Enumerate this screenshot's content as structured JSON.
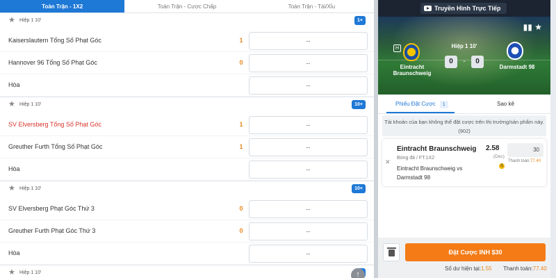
{
  "tabs": [
    "Toàn Trận - 1X2",
    "Toàn Trận - Cược Chấp",
    "Toàn Trận - Tài/Xỉu"
  ],
  "markets": [
    {
      "time": "Hiệp 1 10'",
      "more": "1+",
      "rows": [
        {
          "name": "Kaiserslautern Tổng Số Phạt Góc",
          "num": "1",
          "odd": "--"
        },
        {
          "name": "Hannover 96 Tổng Số Phạt Góc",
          "num": "0",
          "odd": "--"
        },
        {
          "name": "Hòa",
          "num": "",
          "odd": "--"
        }
      ]
    },
    {
      "time": "Hiệp 1 10'",
      "more": "10+",
      "rows": [
        {
          "name": "SV Elversberg Tổng Số Phạt Góc",
          "num": "1",
          "odd": "--"
        },
        {
          "name": "Greuther Furth Tổng Số Phạt Góc",
          "num": "1",
          "odd": "--"
        },
        {
          "name": "Hòa",
          "num": "",
          "odd": "--"
        }
      ]
    },
    {
      "time": "Hiệp 1 10'",
      "more": "10+",
      "rows": [
        {
          "name": "SV Elversberg Phạt Góc Thứ 3",
          "num": "0",
          "odd": "--"
        },
        {
          "name": "Greuther Furth Phạt Góc Thứ 3",
          "num": "0",
          "odd": "--"
        },
        {
          "name": "Hòa",
          "num": "",
          "odd": "--"
        }
      ]
    },
    {
      "time": "Hiệp 1 10'",
      "more": "1+",
      "rows": []
    }
  ],
  "live": {
    "button": "Truyền Hình Trực Tiếp",
    "home_badge": "H",
    "time": "Hiệp 1 10'",
    "home_team": "Eintracht Braunschweig",
    "away_team": "Darmstadt 98",
    "home_score": "0",
    "away_score": "0",
    "dash": "-"
  },
  "betslip": {
    "tab_slip": "Phiếu Đặt Cược",
    "slip_count": "1",
    "tab_statement": "Sao kê",
    "warning": "Tài khoản của bạn không thể đặt cược trên thị trường/sản phẩm này. (902)",
    "selection": "Eintracht Braunschweig",
    "odds": "2.58",
    "odds_format": "(Dec)",
    "league": "Bóng đá / FT.1X2",
    "match": "Eintracht Braunschweig vs Darmstadt 98",
    "stake": "30",
    "payout_label": "Thanh toán:",
    "payout_value": "77.40",
    "place_button": "Đặt Cược INH $30",
    "balance_label": "Số dư hiện tại:",
    "balance_value": "1.55",
    "total_label": "Thanh toán:",
    "total_value": "77.40"
  },
  "colors": {
    "accent": "#1e78d6",
    "orange": "#f47b16",
    "red_text": "#d9342b"
  }
}
